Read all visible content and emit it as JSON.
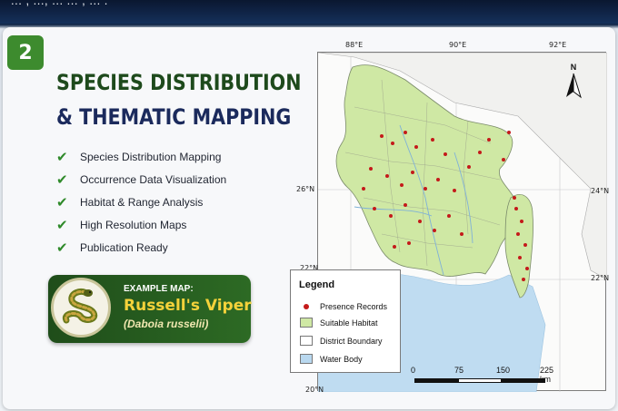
{
  "header": {
    "partial_text": "...   , ..., ... ... , ... ."
  },
  "section": {
    "number": "2",
    "title_line1": "SPECIES DISTRIBUTION",
    "title_line2": "& THEMATIC MAPPING"
  },
  "features": [
    "Species Distribution Mapping",
    "Occurrence Data Visualization",
    "Habitat & Range Analysis",
    "High Resolution Maps",
    "Publication Ready"
  ],
  "example": {
    "label": "EXAMPLE MAP:",
    "common_name": "Russell's Viper",
    "scientific_name": "(Daboia russelii)"
  },
  "map": {
    "lon_ticks": [
      "88°E",
      "90°E",
      "92°E"
    ],
    "lat_ticks_left": [
      "26°N",
      "22°N",
      "20°N"
    ],
    "lat_ticks_right": [
      "24°N",
      "22°N"
    ],
    "north_label": "N",
    "legend": {
      "title": "Legend",
      "items": [
        {
          "label": "Presence Records",
          "type": "dot",
          "color": "#c41a1a"
        },
        {
          "label": "Suitable Habitat",
          "type": "fill",
          "color": "#cfe8a4"
        },
        {
          "label": "District Boundary",
          "type": "outline",
          "color": "#ffffff"
        },
        {
          "label": "Water Body",
          "type": "fill",
          "color": "#b9d8ef"
        }
      ]
    },
    "scale": {
      "labels": [
        "0",
        "75",
        "150",
        "225 km"
      ]
    }
  },
  "colors": {
    "green_dark": "#1e4a1c",
    "navy": "#1b2a5c",
    "accent_green": "#3d8b2e",
    "habitat": "#cfe8a4",
    "water": "#b9d8ef",
    "presence": "#c41a1a"
  }
}
